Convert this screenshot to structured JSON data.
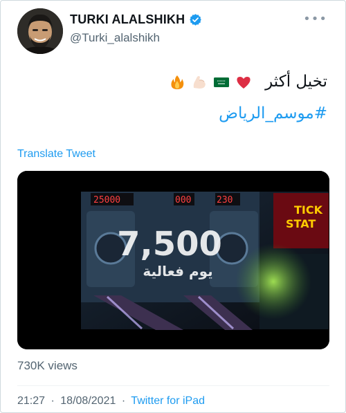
{
  "tweet": {
    "display_name": "TURKI ALALSHIKH",
    "handle": "@Turki_alalshikh",
    "text": "تخيل أكثر",
    "emojis": [
      "heart-emoji",
      "saudi-flag-emoji",
      "flexed-biceps-emoji",
      "fire-emoji"
    ],
    "hashtag": "#موسم_الرياض",
    "translate_label": "Translate Tweet",
    "views": "730K views",
    "time": "21:27",
    "date": "18/08/2021",
    "source": "Twitter for iPad"
  },
  "media": {
    "overlay_number": "7,500",
    "overlay_text": "يوم فعالية",
    "scoreboard_left": "25000",
    "scoreboard_mid": "000",
    "scoreboard_right": "230",
    "sign_text_1": "TICK",
    "sign_text_2": "STAT"
  },
  "colors": {
    "link": "#1d9bf0",
    "secondary_text": "#536471",
    "primary_text": "#0f1419",
    "verified": "#1d9bf0"
  }
}
